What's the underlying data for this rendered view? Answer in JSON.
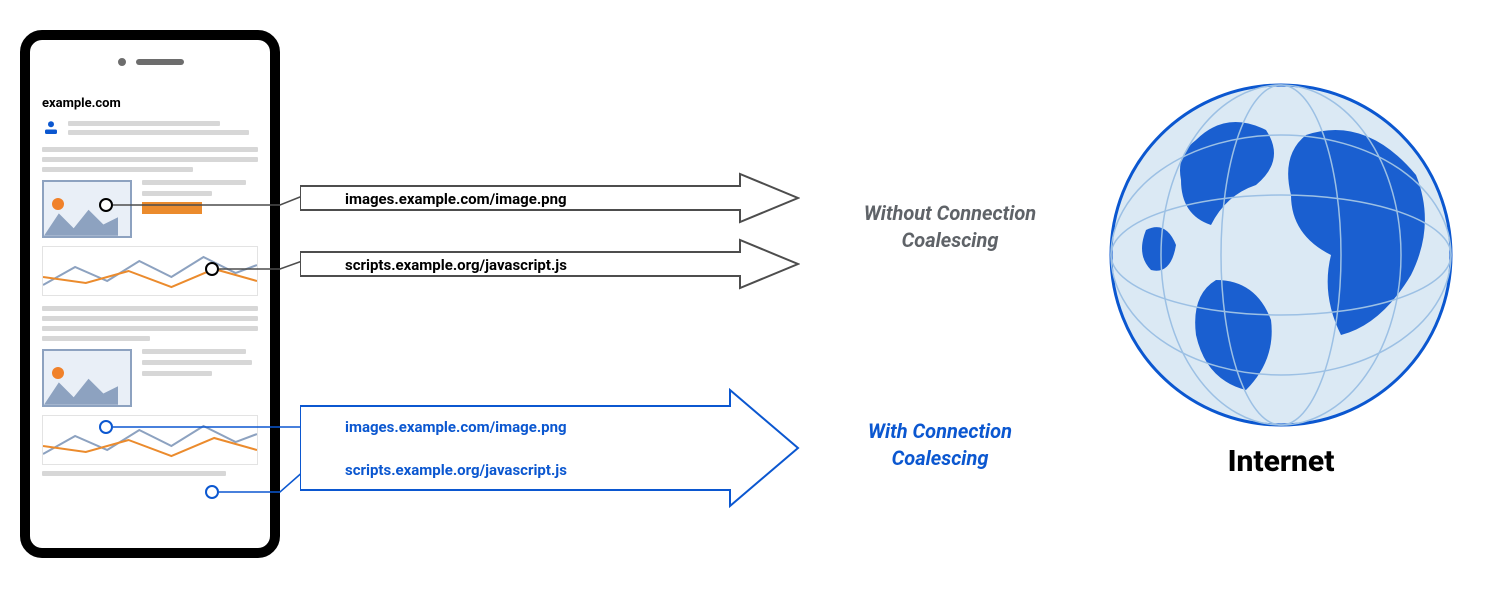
{
  "phone": {
    "url": "example.com"
  },
  "arrows": {
    "without": {
      "req1": "images.example.com/image.png",
      "req2": "scripts.example.org/javascript.js",
      "label_line1": "Without Connection",
      "label_line2": "Coalescing"
    },
    "with": {
      "req1": "images.example.com/image.png",
      "req2": "scripts.example.org/javascript.js",
      "label_line1": "With Connection",
      "label_line2": "Coalescing"
    }
  },
  "globe": {
    "caption": "Internet"
  },
  "colors": {
    "accent_blue": "#0b57d0",
    "accent_orange": "#eb8b2d",
    "grey_text": "#5f6368"
  }
}
